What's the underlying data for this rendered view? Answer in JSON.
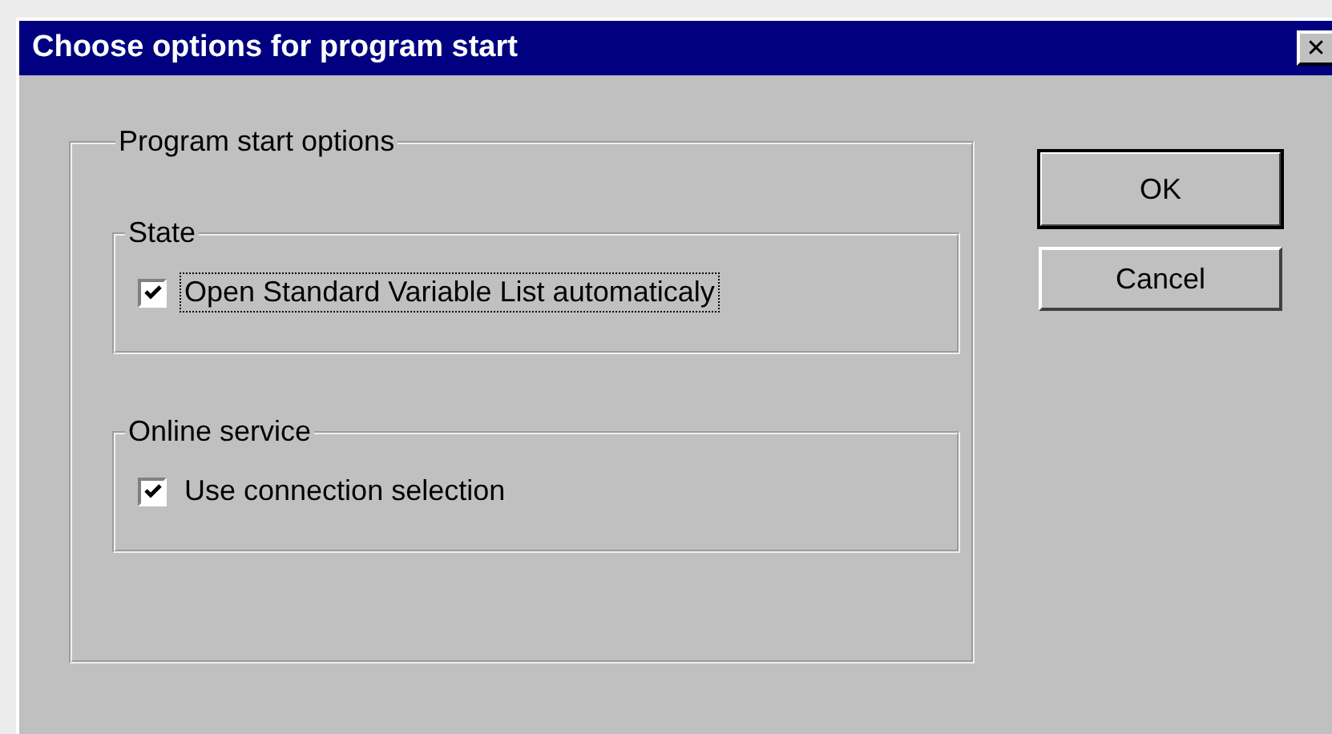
{
  "window": {
    "title": "Choose options for program start",
    "close_glyph": "✕"
  },
  "group": {
    "title": "Program start options",
    "sections": [
      {
        "title": "State",
        "options": [
          {
            "label": "Open Standard Variable List automaticaly",
            "checked": true,
            "focused": true
          }
        ]
      },
      {
        "title": "Online service",
        "options": [
          {
            "label": "Use connection selection",
            "checked": true,
            "focused": false
          }
        ]
      }
    ]
  },
  "buttons": [
    {
      "label": "OK",
      "default": true
    },
    {
      "label": "Cancel",
      "default": false
    }
  ]
}
